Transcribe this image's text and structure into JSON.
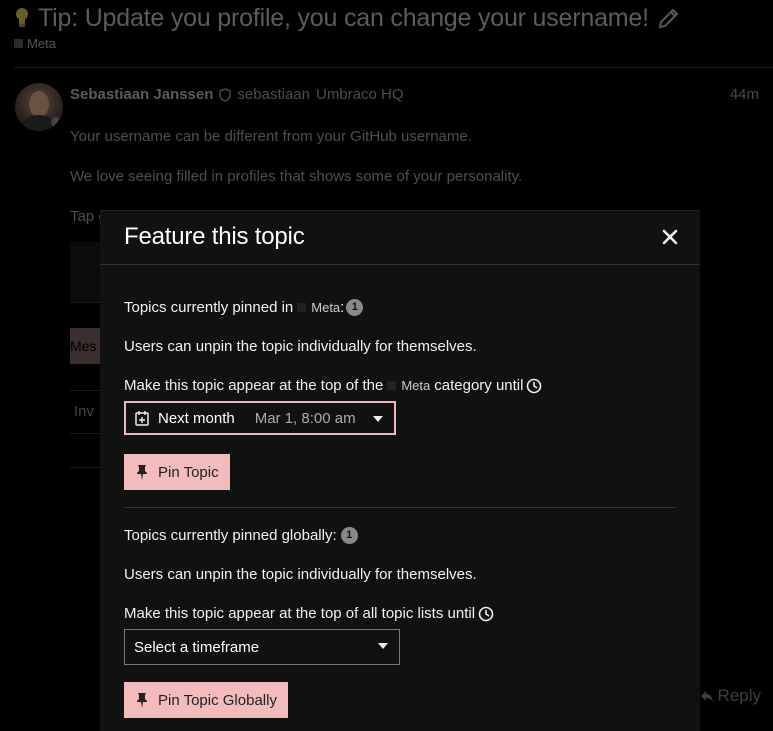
{
  "topic": {
    "title": "Tip: Update you profile, you can change your username!",
    "category": "Meta"
  },
  "post": {
    "author_name": "Sebastiaan Janssen",
    "author_username": "sebastiaan",
    "author_org": "Umbraco HQ",
    "age": "44m",
    "line1": "Your username can be different from your GitHub username.",
    "line2": "We love seeing filled in profiles that shows some of your personality.",
    "line3_visible": "Tap o",
    "button_fragment": "Mes",
    "row_fragment": "Inv",
    "reply_label": "Reply"
  },
  "modal": {
    "title": "Feature this topic",
    "category_section": {
      "pinned_prefix": "Topics currently pinned in",
      "category": "Meta",
      "pinned_suffix": ":",
      "count": "1",
      "unpin_note": "Users can unpin the topic individually for themselves.",
      "appear_prefix": "Make this topic appear at the top of the",
      "appear_category": "Meta",
      "appear_suffix": "category until",
      "preset": "Next month",
      "date": "Mar 1, 8:00 am",
      "button": "Pin Topic"
    },
    "global_section": {
      "pinned_text": "Topics currently pinned globally:",
      "count": "1",
      "unpin_note": "Users can unpin the topic individually for themselves.",
      "appear_text": "Make this topic appear at the top of all topic lists until",
      "select_placeholder": "Select a timeframe",
      "button": "Pin Topic Globally"
    }
  },
  "colors": {
    "background": "#000000",
    "modal_background": "#111111",
    "accent_button": "#f2bcbc",
    "picker_border": "#f0b9b9"
  },
  "icons": [
    "lightbulb-icon",
    "pencil-icon",
    "shield-icon",
    "close-icon",
    "clock-icon",
    "calendar-plus-icon",
    "caret-down-icon",
    "thumbtack-icon",
    "reply-icon"
  ]
}
